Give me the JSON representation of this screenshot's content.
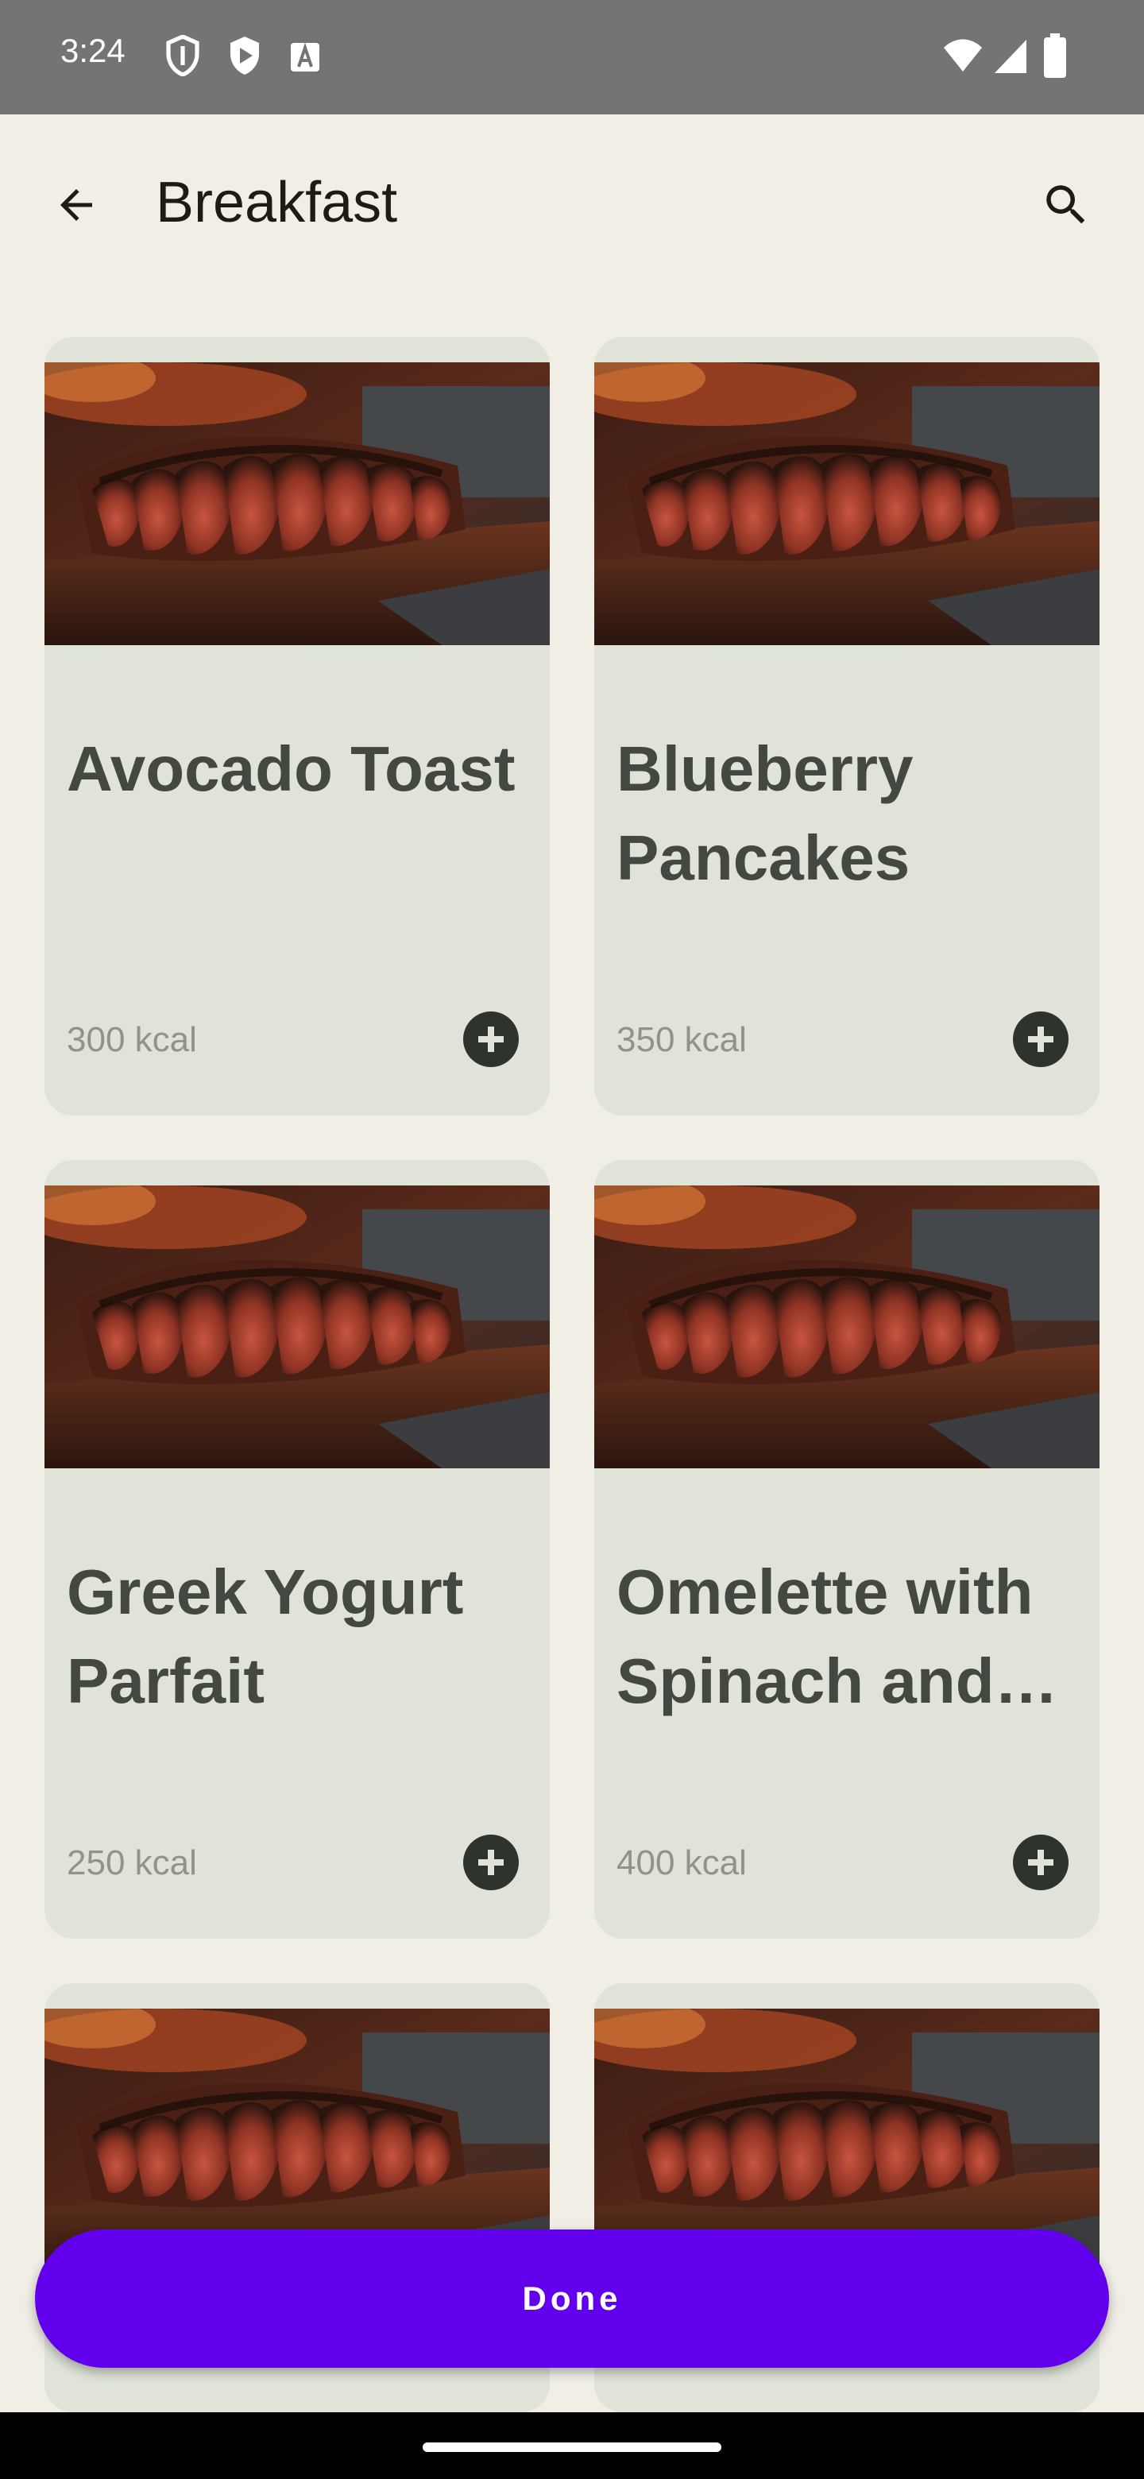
{
  "status_bar": {
    "time": "3:24",
    "icons": [
      "vpn-shield-icon",
      "play-store-icon",
      "font-a-icon",
      "wifi-icon",
      "signal-icon",
      "battery-icon"
    ]
  },
  "app_bar": {
    "title": "Breakfast",
    "back_icon": "arrow-back-icon",
    "search_icon": "search-icon"
  },
  "colors": {
    "background": "#f1eee6",
    "card": "#e0e3d8",
    "primary_button": "#6200ee",
    "title_text": "#201a17",
    "card_title_text": "#434840",
    "kcal_text": "#8f938a",
    "add_icon": "#2f332e"
  },
  "meals": [
    {
      "name": "Avocado Toast",
      "kcal": "300 kcal",
      "add_icon": "add-circle-icon"
    },
    {
      "name": "Blueberry Pancakes",
      "kcal": "350 kcal",
      "add_icon": "add-circle-icon"
    },
    {
      "name": "Greek Yogurt Parfait",
      "kcal": "250 kcal",
      "add_icon": "add-circle-icon"
    },
    {
      "name": "Omelette with Spinach and Feta",
      "kcal": "400 kcal",
      "add_icon": "add-circle-icon"
    }
  ],
  "done_button": {
    "label": "Done"
  }
}
